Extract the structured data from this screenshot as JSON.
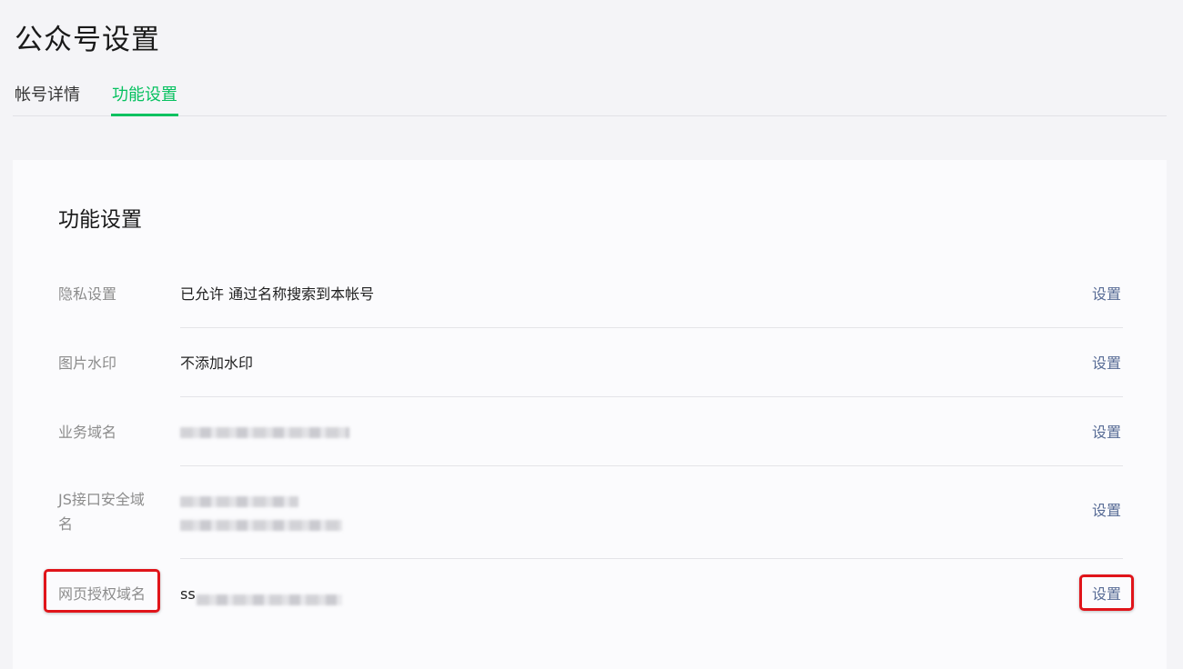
{
  "header": {
    "title": "公众号设置"
  },
  "tabs": [
    {
      "label": "帐号详情",
      "active": false
    },
    {
      "label": "功能设置",
      "active": true
    }
  ],
  "section": {
    "title": "功能设置",
    "rows": [
      {
        "label": "隐私设置",
        "value": "已允许 通过名称搜索到本帐号",
        "action": "设置"
      },
      {
        "label": "图片水印",
        "value": "不添加水印",
        "action": "设置"
      },
      {
        "label": "业务域名",
        "value": "",
        "action": "设置"
      },
      {
        "label": "JS接口安全域名",
        "value": "",
        "action": "设置"
      },
      {
        "label": "网页授权域名",
        "value": "ss",
        "action": "设置"
      }
    ]
  },
  "colors": {
    "accent": "#07c160",
    "link": "#576b95",
    "highlight": "#e0141a"
  }
}
